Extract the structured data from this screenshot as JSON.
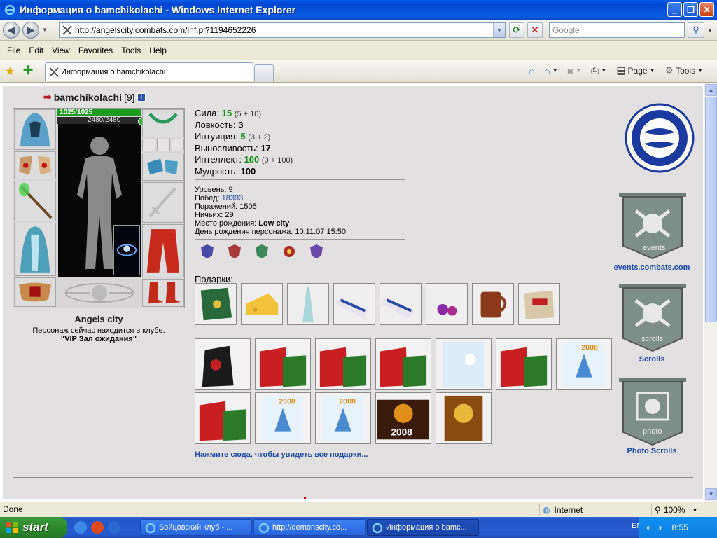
{
  "window": {
    "title": "Информация о bamchikolachi - Windows Internet Explorer",
    "url": "http://angelscity.combats.com/inf.pl?1194652226",
    "search_placeholder": "Google"
  },
  "menu": [
    "File",
    "Edit",
    "View",
    "Favorites",
    "Tools",
    "Help"
  ],
  "tab": {
    "label": "Информация о bamchikolachi"
  },
  "toolbar": {
    "page_label": "Page",
    "tools_label": "Tools"
  },
  "character": {
    "name": "bamchikolachi",
    "level_tag": "[9]",
    "hp": "1025/1025",
    "mana": "2480/2480",
    "city": "Angels city",
    "club_line": "Персонаж сейчас находится в клубе.",
    "club_room": "\"VIP Зал ожидания\""
  },
  "stats": [
    {
      "label": "Сила:",
      "value": "15",
      "extra": "(5 + 10)",
      "green": true
    },
    {
      "label": "Ловкость:",
      "value": "3",
      "extra": "",
      "green": false
    },
    {
      "label": "Интуиция:",
      "value": "5",
      "extra": "(3 + 2)",
      "green": true
    },
    {
      "label": "Выносливость:",
      "value": "17",
      "extra": "",
      "green": false
    },
    {
      "label": "Интеллект:",
      "value": "100",
      "extra": "(0 + 100)",
      "green": true
    },
    {
      "label": "Мудрость:",
      "value": "100",
      "extra": "",
      "green": false
    }
  ],
  "info": {
    "level_label": "Уровень:",
    "level": "9",
    "wins_label": "Побед:",
    "wins": "18393",
    "losses_label": "Поражений:",
    "losses": "1505",
    "draws_label": "Ничьих:",
    "draws": "29",
    "birthplace_label": "Место рождения:",
    "birthplace": "Low city",
    "birthday_label": "День рождения персонажа:",
    "birthday": "10.11.07 15:50"
  },
  "gifts": {
    "label": "Подарки:",
    "see_all": "Нажмите сюда, чтобы увидеть все подарки...",
    "small": [
      "book",
      "cheese",
      "tower",
      "vaseline-tube",
      "vaseline-tube",
      "potions",
      "mug",
      "parcel"
    ],
    "bags_row1": [
      "dark-gift-bag",
      "red-gift-bag",
      "red-gift-bag",
      "red-gift-bag",
      "snow-card",
      "red-gift-bag",
      "card-2008"
    ],
    "bags_row2": [
      "red-gift-bag",
      "card-2008",
      "card-2008",
      "fireworks-card-2008",
      "golden-card"
    ],
    "card_year": "2008"
  },
  "sidebar": {
    "events_label": "events.combats.com",
    "events_banner_text": "events",
    "scrolls_label": "Scrolls",
    "scrolls_banner_text": "scrolls",
    "photo_label": "Photo Scrolls",
    "photo_banner_text": "photo"
  },
  "status": {
    "text": "Done",
    "zone": "Internet",
    "zoom": "100%"
  },
  "taskbar": {
    "start": "start",
    "buttons": [
      "Бойцовский клуб - ...",
      "http://demonscity.co...",
      "Информация о bamc..."
    ],
    "lang": "EN",
    "clock": "8:55"
  },
  "colors": {
    "link": "#1b4aa3",
    "stat_green": "#0b8f0b",
    "hp_green": "#1d9b1d"
  }
}
